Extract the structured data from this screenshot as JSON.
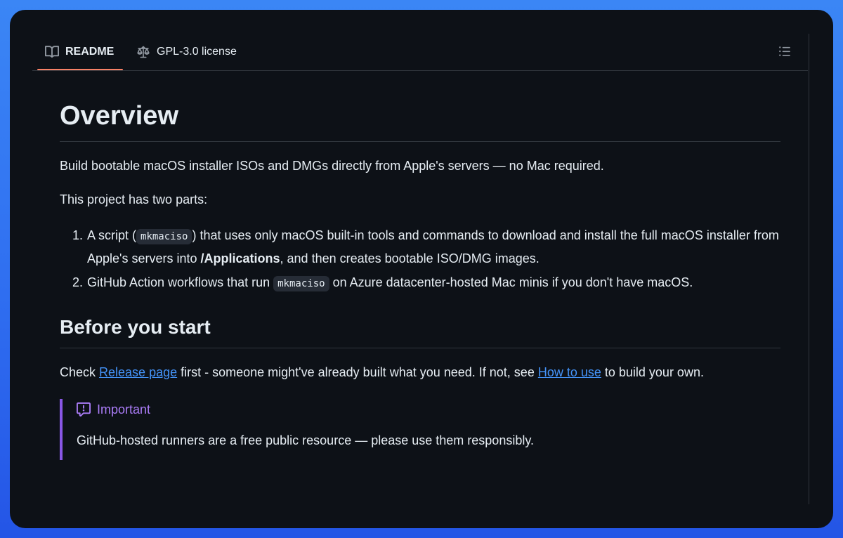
{
  "tabs": {
    "readme": "README",
    "license": "GPL-3.0 license"
  },
  "icons": {
    "readme": "book-icon",
    "license": "law-scale-icon",
    "outline": "list-unordered-icon",
    "important": "report-icon"
  },
  "colors": {
    "background": "#0d1117",
    "text": "#e6edf3",
    "link": "#4493f8",
    "tab_active_underline": "#f78166",
    "important_accent": "#8957e5",
    "important_title": "#ab7df8",
    "border": "#30363d"
  },
  "readme": {
    "h1": "Overview",
    "intro": "Build bootable macOS installer ISOs and DMGs directly from Apple's servers — no Mac required.",
    "parts_intro": "This project has two parts:",
    "list": [
      {
        "pre": "A script (",
        "code": "mkmaciso",
        "mid": ") that uses only macOS built-in tools and commands to download and install the full macOS installer from Apple's servers into ",
        "bold": "/Applications",
        "post": ", and then creates bootable ISO/DMG images."
      },
      {
        "pre": "GitHub Action workflows that run ",
        "code": "mkmaciso",
        "post": " on Azure datacenter-hosted Mac minis if you don't have macOS."
      }
    ],
    "h2": "Before you start",
    "check": {
      "pre": "Check ",
      "link1": "Release page",
      "mid": " first - someone might've already built what you need. If not, see ",
      "link2": "How to use",
      "post": " to build your own."
    },
    "alert": {
      "title": "Important",
      "body": "GitHub-hosted runners are a free public resource — please use them responsibly."
    }
  }
}
